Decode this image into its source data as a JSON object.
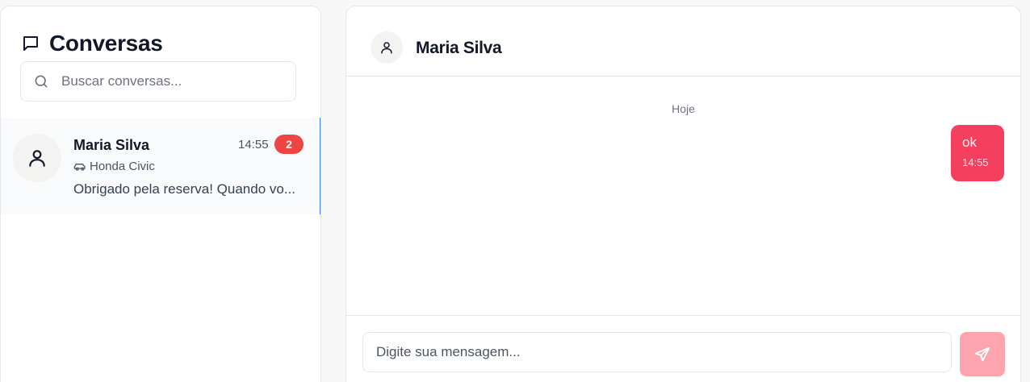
{
  "sidebar": {
    "title": "Conversas",
    "title_icon": "chat-bubble-icon",
    "search": {
      "placeholder": "Buscar conversas...",
      "value": "",
      "icon": "search-icon"
    },
    "conversations": [
      {
        "name": "Maria Silva",
        "time": "14:55",
        "unread": "2",
        "car": "Honda Civic",
        "preview": "Obrigado pela reserva! Quando vo...",
        "avatar_icon": "user-icon",
        "car_icon": "car-icon",
        "active": true
      }
    ]
  },
  "chat": {
    "contact_name": "Maria Silva",
    "avatar_icon": "user-icon",
    "day_label": "Hoje",
    "messages": [
      {
        "text": "ok",
        "time": "14:55",
        "outgoing": true
      }
    ],
    "composer": {
      "placeholder": "Digite sua mensagem...",
      "value": "",
      "send_icon": "send-icon"
    }
  },
  "colors": {
    "accent": "#f43f5e",
    "send_button_disabled": "#fda4af",
    "badge": "#ef4444",
    "active_indicator": "#3b82f6"
  }
}
